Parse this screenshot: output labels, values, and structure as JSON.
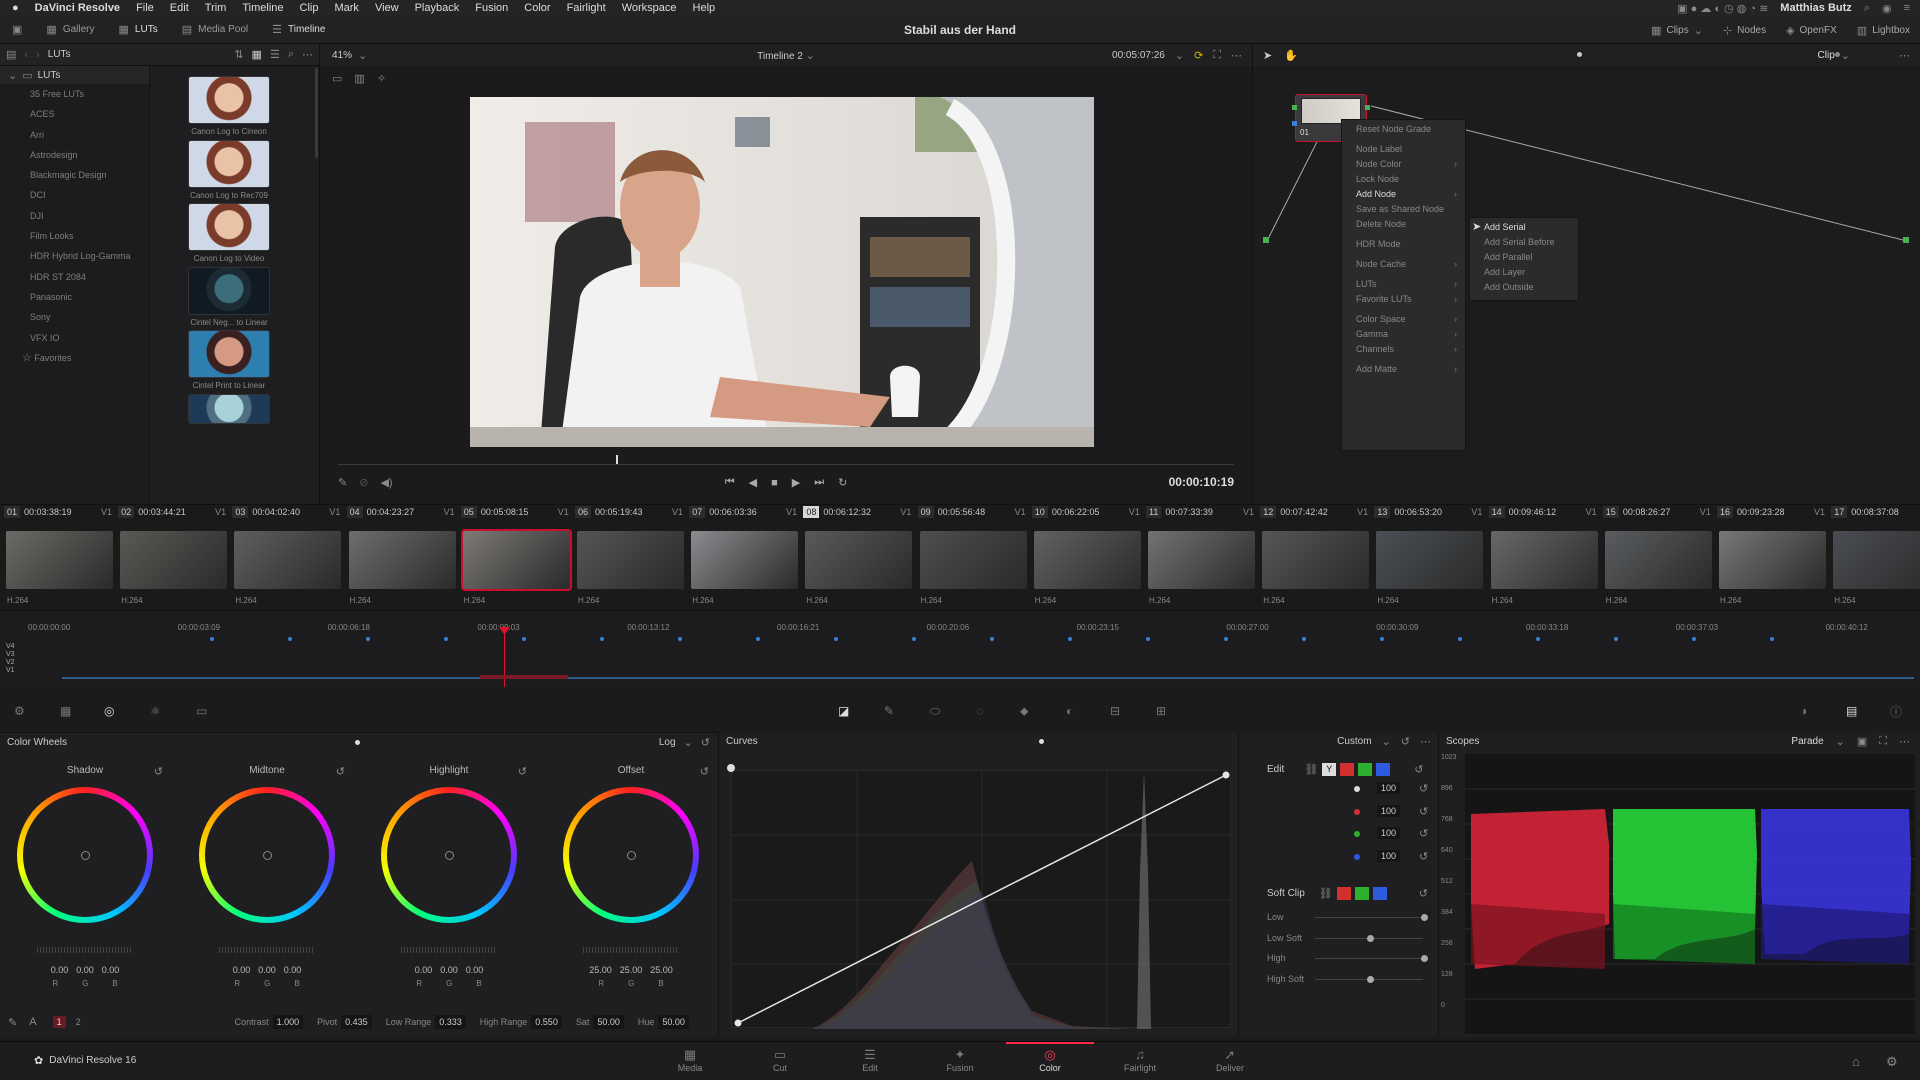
{
  "menubar": {
    "apple": "",
    "items": [
      "DaVinci Resolve",
      "File",
      "Edit",
      "Trim",
      "Timeline",
      "Clip",
      "Mark",
      "View",
      "Playback",
      "Fusion",
      "Color",
      "Fairlight",
      "Workspace",
      "Help"
    ],
    "user": "Matthias Butz"
  },
  "toolbar": {
    "left": [
      {
        "label": "Gallery"
      },
      {
        "label": "LUTs"
      },
      {
        "label": "Media Pool"
      },
      {
        "label": "Timeline"
      }
    ],
    "project_title": "Stabil aus der Hand",
    "right": [
      {
        "label": "Clips"
      },
      {
        "label": "Nodes"
      },
      {
        "label": "OpenFX"
      },
      {
        "label": "Lightbox"
      }
    ]
  },
  "lut_browser": {
    "header": "LUTs",
    "zoom": "41%",
    "root": "LUTs",
    "folders": [
      "35 Free LUTs",
      "ACES",
      "Arri",
      "Astrodesign",
      "Blackmagic Design",
      "DCI",
      "DJI",
      "Film Looks",
      "HDR Hybrid Log-Gamma",
      "HDR ST 2084",
      "Panasonic",
      "Sony",
      "VFX IO"
    ],
    "favorites": "Favorites",
    "thumbnails": [
      "Canon Log to Cineon",
      "Canon Log to Rec709",
      "Canon Log to Video",
      "Cintel Neg... to Linear",
      "Cintel Print to Linear"
    ]
  },
  "viewer": {
    "timeline_name": "Timeline 2",
    "timecode_top": "00:05:07:26",
    "timecode_current": "00:00:10:19",
    "playhead_fraction": 0.31
  },
  "node_editor": {
    "mode": "Clip",
    "node_label": "01",
    "context_menu": [
      {
        "label": "Reset Node Grade",
        "sub": false,
        "gap": false
      },
      {
        "label": "Node Label",
        "sub": false,
        "gap": true
      },
      {
        "label": "Node Color",
        "sub": true,
        "gap": false
      },
      {
        "label": "Lock Node",
        "sub": false,
        "gap": false
      },
      {
        "label": "Add Node",
        "sub": true,
        "gap": false,
        "active": true
      },
      {
        "label": "Save as Shared Node",
        "sub": false,
        "gap": false
      },
      {
        "label": "Delete Node",
        "sub": false,
        "gap": false
      },
      {
        "label": "HDR Mode",
        "sub": false,
        "gap": true
      },
      {
        "label": "Node Cache",
        "sub": true,
        "gap": true
      },
      {
        "label": "LUTs",
        "sub": true,
        "gap": true
      },
      {
        "label": "Favorite LUTs",
        "sub": true,
        "gap": false
      },
      {
        "label": "Color Space",
        "sub": true,
        "gap": true
      },
      {
        "label": "Gamma",
        "sub": true,
        "gap": false
      },
      {
        "label": "Channels",
        "sub": true,
        "gap": false
      },
      {
        "label": "Add Matte",
        "sub": true,
        "gap": true
      }
    ],
    "submenu": [
      "Add Serial",
      "Add Serial Before",
      "Add Parallel",
      "Add Layer",
      "Add Outside"
    ]
  },
  "clips": [
    {
      "n": "01",
      "tc": "00:03:38:19",
      "track": "V1",
      "codec": "H.264",
      "img": "#6c6b66"
    },
    {
      "n": "02",
      "tc": "00:03:44:21",
      "track": "V1",
      "codec": "H.264",
      "img": "#5b5955"
    },
    {
      "n": "03",
      "tc": "00:04:02:40",
      "track": "V1",
      "codec": "H.264",
      "img": "#5f5f5d"
    },
    {
      "n": "04",
      "tc": "00:04:23:27",
      "track": "V1",
      "codec": "H.264",
      "img": "#6e6e6e"
    },
    {
      "n": "05",
      "tc": "00:05:08:15",
      "track": "V1",
      "codec": "H.264",
      "img": "#7d7a76",
      "sel": true
    },
    {
      "n": "06",
      "tc": "00:05:19:43",
      "track": "V1",
      "codec": "H.264",
      "img": "#535557"
    },
    {
      "n": "07",
      "tc": "00:06:03:36",
      "track": "V1",
      "codec": "H.264",
      "img": "#8a8c8f"
    },
    {
      "n": "08",
      "tc": "00:06:12:32",
      "track": "V1",
      "codec": "H.264",
      "img": "#5a5a58",
      "cur": true
    },
    {
      "n": "09",
      "tc": "00:05:56:48",
      "track": "V1",
      "codec": "H.264",
      "img": "#4e4e4e"
    },
    {
      "n": "10",
      "tc": "00:06:22:05",
      "track": "V1",
      "codec": "H.264",
      "img": "#616263"
    },
    {
      "n": "11",
      "tc": "00:07:33:39",
      "track": "V1",
      "codec": "H.264",
      "img": "#737373"
    },
    {
      "n": "12",
      "tc": "00:07:42:42",
      "track": "V1",
      "codec": "H.264",
      "img": "#565656"
    },
    {
      "n": "13",
      "tc": "00:06:53:20",
      "track": "V1",
      "codec": "H.264",
      "img": "#4b5055"
    },
    {
      "n": "14",
      "tc": "00:09:46:12",
      "track": "V1",
      "codec": "H.264",
      "img": "#6a6866"
    },
    {
      "n": "15",
      "tc": "00:08:26:27",
      "track": "V1",
      "codec": "H.264",
      "img": "#5a5d60"
    },
    {
      "n": "16",
      "tc": "00:09:23:28",
      "track": "V1",
      "codec": "H.264",
      "img": "#777879"
    },
    {
      "n": "17",
      "tc": "00:08:37:08",
      "track": "",
      "codec": "H.264",
      "img": "#4a4d52"
    }
  ],
  "mini_timeline": {
    "ruler": [
      "00:00:00:00",
      "00:00:03:09",
      "00:00:06:18",
      "00:00:09:03",
      "00:00:13:12",
      "00:00:16:21",
      "00:00:20:06",
      "00:00:23:15",
      "00:00:27:00",
      "00:00:30:09",
      "00:00:33:18",
      "00:00:37:03",
      "00:00:40:12"
    ],
    "tracks": [
      "V4",
      "V3",
      "V2",
      "V1"
    ]
  },
  "color_wheels": {
    "title": "Color Wheels",
    "mode": "Log",
    "wheels": [
      {
        "name": "Shadow",
        "vals": [
          "0.00",
          "0.00",
          "0.00"
        ]
      },
      {
        "name": "Midtone",
        "vals": [
          "0.00",
          "0.00",
          "0.00"
        ]
      },
      {
        "name": "Highlight",
        "vals": [
          "0.00",
          "0.00",
          "0.00"
        ]
      },
      {
        "name": "Offset",
        "vals": [
          "25.00",
          "25.00",
          "25.00"
        ]
      }
    ],
    "rgb": [
      "R",
      "G",
      "B"
    ],
    "footer": {
      "page1": "1",
      "page2": "2",
      "contrast_l": "Contrast",
      "contrast": "1.000",
      "pivot_l": "Pivot",
      "pivot": "0.435",
      "lowr_l": "Low Range",
      "lowr": "0.333",
      "highr_l": "High Range",
      "highr": "0.550",
      "sat_l": "Sat",
      "sat": "50.00",
      "hue_l": "Hue",
      "hue": "50.00"
    }
  },
  "curves": {
    "title": "Curves",
    "mode": "Custom"
  },
  "edit_panel": {
    "title": "Edit",
    "channel_y": "Y",
    "vals": [
      "100",
      "100",
      "100",
      "100"
    ],
    "softclip": "Soft Clip",
    "soft_labels": [
      "Low",
      "Low Soft",
      "High",
      "High Soft"
    ]
  },
  "scopes": {
    "title": "Scopes",
    "mode": "Parade",
    "scale": [
      "1023",
      "896",
      "768",
      "640",
      "512",
      "384",
      "256",
      "128",
      "0"
    ]
  },
  "pages": {
    "app": "DaVinci Resolve 16",
    "items": [
      {
        "label": "Media",
        "icon": "▦"
      },
      {
        "label": "Cut",
        "icon": "▭"
      },
      {
        "label": "Edit",
        "icon": "☰"
      },
      {
        "label": "Fusion",
        "icon": "✦"
      },
      {
        "label": "Color",
        "icon": "◎",
        "on": true
      },
      {
        "label": "Fairlight",
        "icon": "♫"
      },
      {
        "label": "Deliver",
        "icon": "➚"
      }
    ]
  }
}
